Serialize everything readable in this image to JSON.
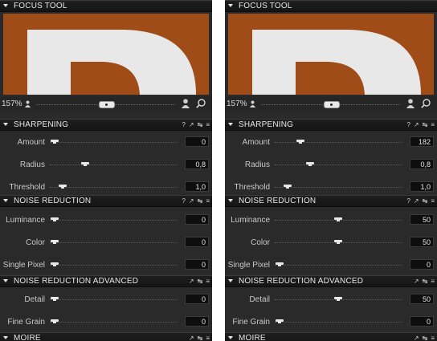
{
  "panels": [
    {
      "focus_tool": {
        "title": "FOCUS TOOL",
        "zoom": "157%",
        "zoom_slider": 0.5
      },
      "sharpening": {
        "title": "SHARPENING",
        "tools": [
          "?",
          "↗",
          "↹",
          "≡"
        ],
        "rows": [
          {
            "label": "Amount",
            "value": "0",
            "pos": 0.04
          },
          {
            "label": "Radius",
            "value": "0,8",
            "pos": 0.28
          },
          {
            "label": "Threshold",
            "value": "1,0",
            "pos": 0.1
          }
        ]
      },
      "noise_reduction": {
        "title": "NOISE REDUCTION",
        "tools": [
          "?",
          "↗",
          "↹",
          "≡"
        ],
        "rows": [
          {
            "label": "Luminance",
            "value": "0",
            "pos": 0.04
          },
          {
            "label": "Color",
            "value": "0",
            "pos": 0.04
          },
          {
            "label": "Single Pixel",
            "value": "0",
            "pos": 0.04
          }
        ]
      },
      "noise_reduction_advanced": {
        "title": "NOISE REDUCTION ADVANCED",
        "tools": [
          "↗",
          "↹",
          "≡"
        ],
        "rows": [
          {
            "label": "Detail",
            "value": "0",
            "pos": 0.04
          },
          {
            "label": "Fine Grain",
            "value": "0",
            "pos": 0.04
          }
        ]
      },
      "moire": {
        "title": "MOIRE",
        "tools": [
          "↗",
          "↹",
          "≡"
        ]
      }
    },
    {
      "focus_tool": {
        "title": "FOCUS TOOL",
        "zoom": "157%",
        "zoom_slider": 0.5
      },
      "sharpening": {
        "title": "SHARPENING",
        "tools": [
          "?",
          "↗",
          "↹",
          "≡"
        ],
        "rows": [
          {
            "label": "Amount",
            "value": "182",
            "pos": 0.2
          },
          {
            "label": "Radius",
            "value": "0,8",
            "pos": 0.28
          },
          {
            "label": "Threshold",
            "value": "1,0",
            "pos": 0.1
          }
        ]
      },
      "noise_reduction": {
        "title": "NOISE REDUCTION",
        "tools": [
          "?",
          "↗",
          "↹",
          "≡"
        ],
        "rows": [
          {
            "label": "Luminance",
            "value": "50",
            "pos": 0.5
          },
          {
            "label": "Color",
            "value": "50",
            "pos": 0.5
          },
          {
            "label": "Single Pixel",
            "value": "0",
            "pos": 0.04
          }
        ]
      },
      "noise_reduction_advanced": {
        "title": "NOISE REDUCTION ADVANCED",
        "tools": [
          "↗",
          "↹",
          "≡"
        ],
        "rows": [
          {
            "label": "Detail",
            "value": "50",
            "pos": 0.5
          },
          {
            "label": "Fine Grain",
            "value": "0",
            "pos": 0.04
          }
        ]
      },
      "moire": {
        "title": "MOIRE",
        "tools": [
          "↗",
          "↹",
          "≡"
        ]
      }
    }
  ],
  "colors": {
    "preview_bg": "#a04c18",
    "letter": "#e8e8e8"
  },
  "icons": [
    "collapse-triangle-icon",
    "person-small-icon",
    "person-large-icon",
    "search-icon",
    "help-icon",
    "copy-icon",
    "reset-icon",
    "menu-icon"
  ]
}
